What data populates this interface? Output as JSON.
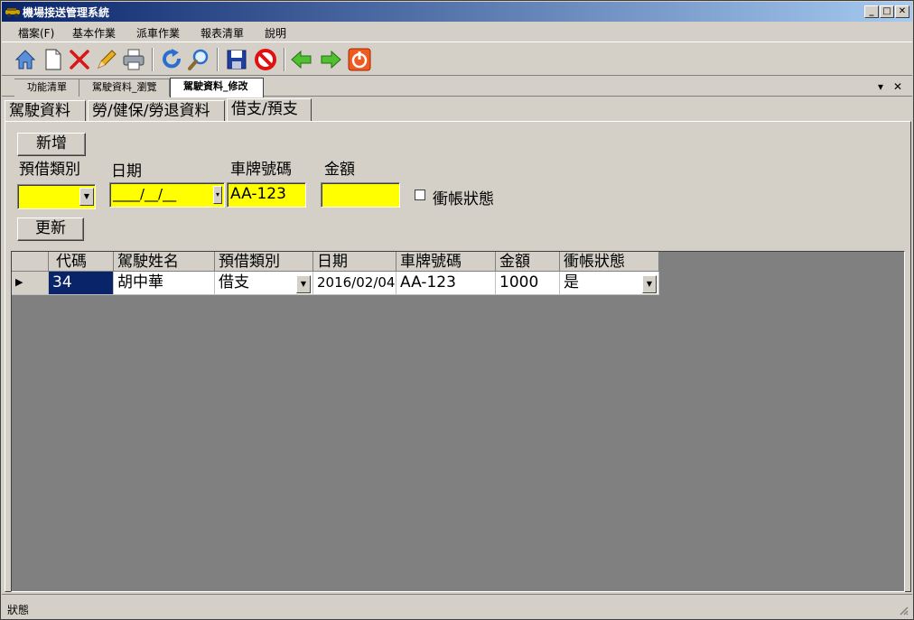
{
  "window": {
    "title": "機場接送管理系統"
  },
  "menu": [
    "檔案(F)",
    "基本作業",
    "派車作業",
    "報表清單",
    "說明"
  ],
  "toolbar": {
    "icons": [
      "home-icon",
      "new-document-icon",
      "delete-icon",
      "edit-icon",
      "print-icon",
      "refresh-icon",
      "search-icon",
      "save-icon",
      "stop-icon",
      "back-icon",
      "forward-icon",
      "power-icon"
    ]
  },
  "doc_tabs": [
    "功能清單",
    "駕駛資料_瀏覽",
    "駕駛資料_修改"
  ],
  "inner_tabs": [
    "駕駛資料",
    "勞/健保/勞退資料",
    "借支/預支"
  ],
  "form": {
    "add_label": "新增",
    "update_label": "更新",
    "type_label": "預借類別",
    "type_value": "",
    "date_label": "日期",
    "date_value": "____/__/__",
    "plate_label": "車牌號碼",
    "plate_value": "AA-123",
    "amount_label": "金額",
    "amount_value": "",
    "settle_label": "衝帳狀態"
  },
  "grid": {
    "columns": [
      "代碼",
      "駕駛姓名",
      "預借類別",
      "日期",
      "車牌號碼",
      "金額",
      "衝帳狀態"
    ],
    "rows": [
      [
        "34",
        "胡中華",
        "借支",
        "2016/02/04",
        "AA-123",
        "1000",
        "是"
      ]
    ]
  },
  "status": {
    "text": "狀態"
  },
  "colors": {
    "title_start": "#0a246a",
    "title_end": "#a6caf0",
    "field_highlight": "#ffff00",
    "grid_background": "#808080",
    "selection": "#0a246a"
  }
}
